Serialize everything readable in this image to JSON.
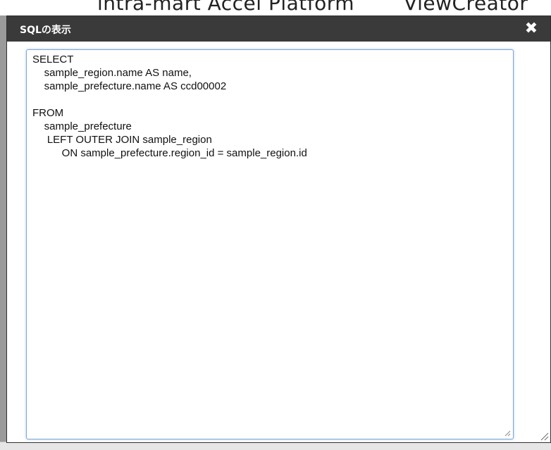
{
  "page": {
    "heading_part1": "intra-mart Accel Platform",
    "heading_part2": "ViewCreator"
  },
  "dialog": {
    "title": "SQLの表示",
    "close_glyph": "✖",
    "close_icon": "close-icon",
    "sql_lines": [
      "SELECT",
      "    sample_region.name AS name,",
      "    sample_prefecture.name AS ccd00002",
      "",
      "FROM",
      "    sample_prefecture",
      "     LEFT OUTER JOIN sample_region",
      "          ON sample_prefecture.region_id = sample_region.id"
    ]
  },
  "colors": {
    "titlebar": "#3a3a3a",
    "textarea_border": "#7fa7d8"
  }
}
